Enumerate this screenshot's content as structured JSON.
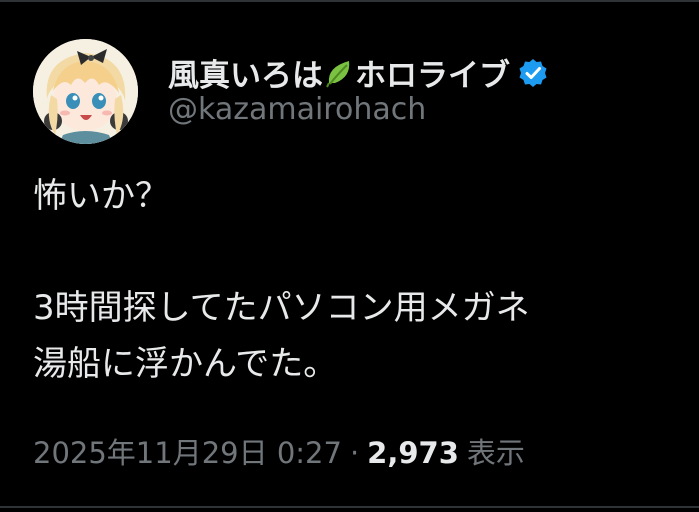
{
  "author": {
    "display_name": "風真いろは",
    "display_name_suffix": "ホロライブ",
    "handle": "@kazamairohach",
    "verified": true,
    "badge_icon": "verified-badge-icon",
    "emoji_icon": "leaf-icon"
  },
  "tweet": {
    "text": "怖いか？\n\n3時間探してたパソコン用メガネ\n湯船に浮かんでた。"
  },
  "meta": {
    "timestamp": "2025年11月29日 0:27",
    "separator": "·",
    "views_count": "2,973",
    "views_label": "表示"
  },
  "colors": {
    "background": "#000000",
    "text_primary": "#e7e9ea",
    "text_secondary": "#71767b",
    "verified_blue": "#1d9bf0",
    "leaf_green": "#7cc242",
    "divider": "#2f3336"
  }
}
